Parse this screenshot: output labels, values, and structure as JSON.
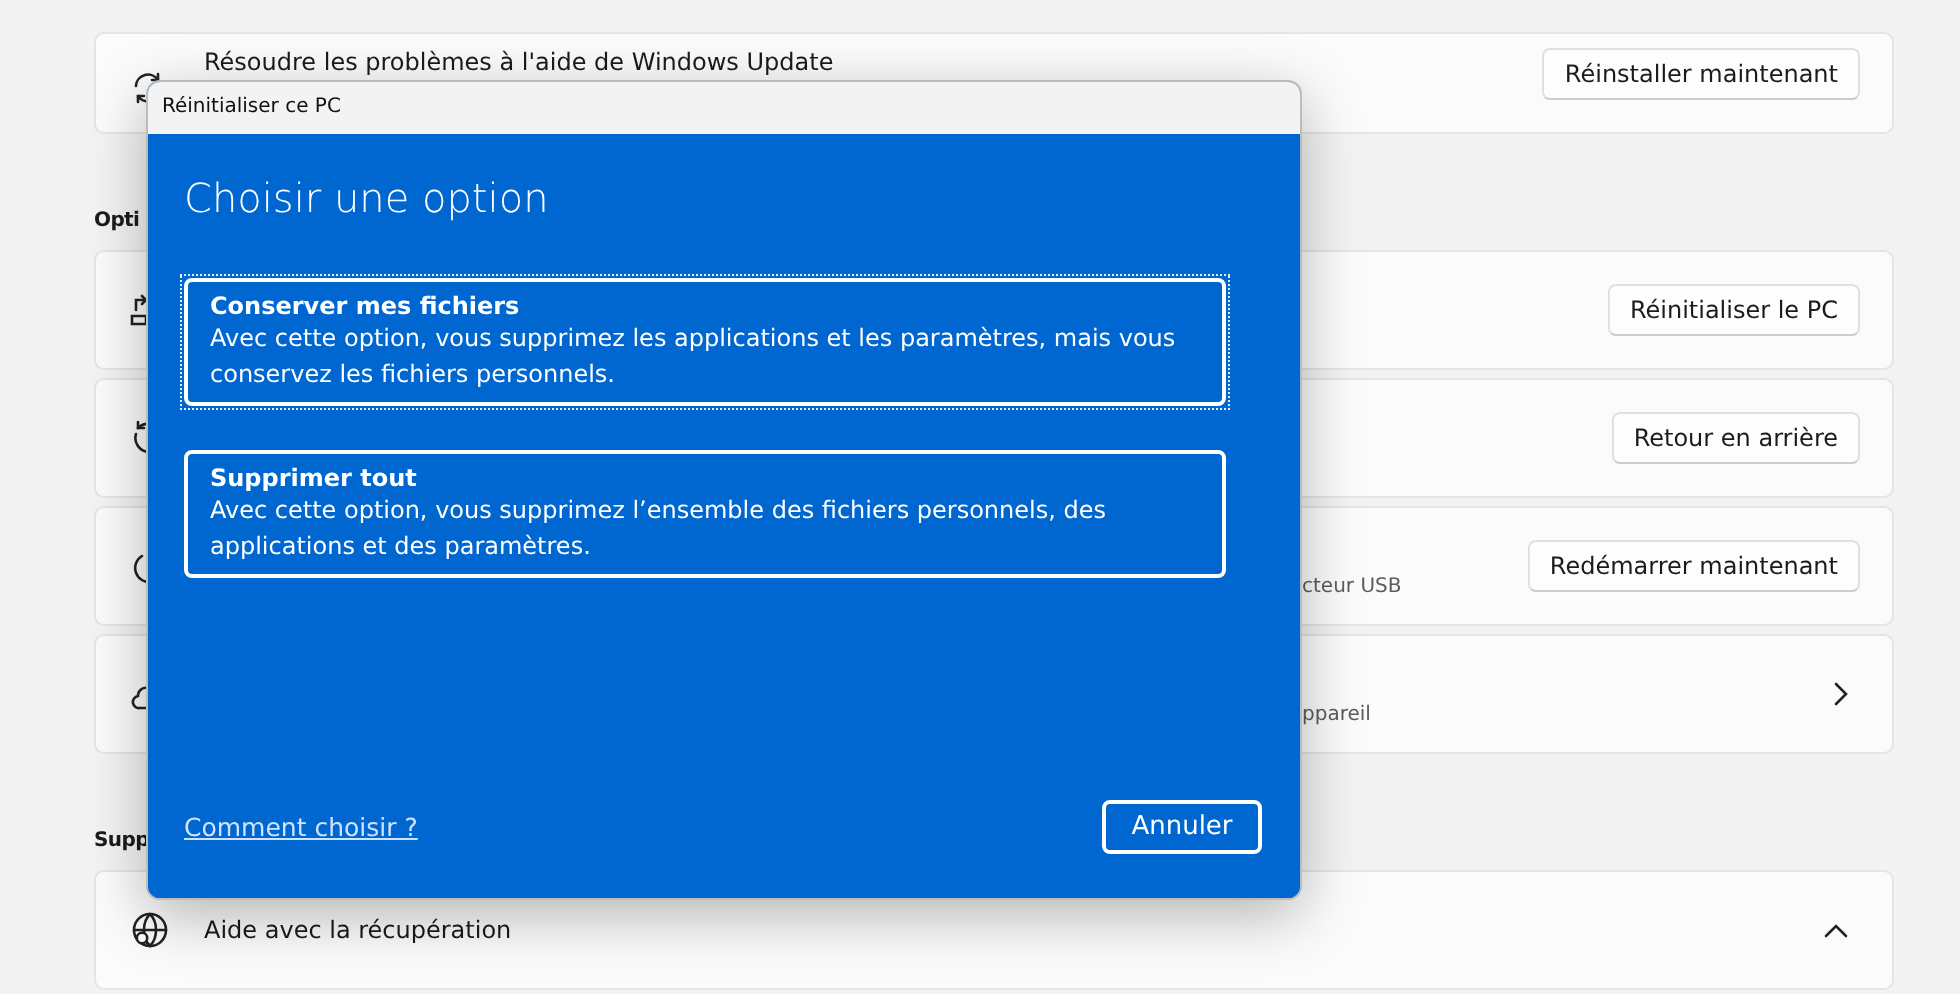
{
  "settings": {
    "top_card": {
      "title": "Résoudre les problèmes à l'aide de Windows Update",
      "button": "Réinstaller maintenant"
    },
    "sections": [
      {
        "heading": "Opti",
        "cards": [
          {
            "kind": "button",
            "button": "Réinitialiser le PC"
          },
          {
            "kind": "button",
            "button": "Retour en arrière"
          },
          {
            "kind": "button",
            "subtitle": "cteur USB",
            "button": "Redémarrer maintenant"
          },
          {
            "kind": "link",
            "subtitle": "ppareil"
          }
        ]
      },
      {
        "heading": "Supp",
        "cards": [
          {
            "kind": "expander",
            "title": "Aide avec la récupération",
            "expanded": true
          }
        ]
      }
    ]
  },
  "dialog": {
    "title": "Réinitialiser ce PC",
    "heading": "Choisir une option",
    "options": [
      {
        "title": "Conserver mes fichiers",
        "description": "Avec cette option, vous supprimez les applications et les paramètres, mais vous conservez les fichiers personnels.",
        "selected": true
      },
      {
        "title": "Supprimer tout",
        "description": "Avec cette option, vous supprimez l’ensemble des fichiers personnels, des applications et des paramètres.",
        "selected": false
      }
    ],
    "link": "Comment choisir ?",
    "cancel_button": "Annuler"
  }
}
